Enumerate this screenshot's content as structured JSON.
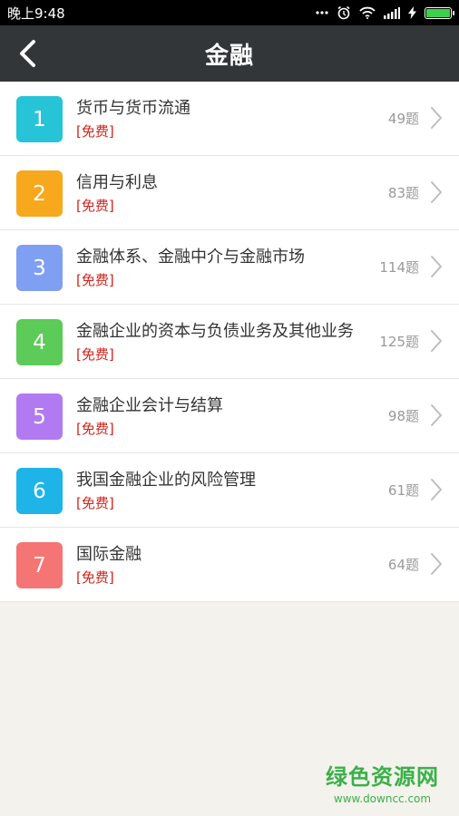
{
  "status_bar": {
    "time": "晚上9:48",
    "signal_icon": "signal-icon",
    "wifi_icon": "wifi-icon",
    "alarm_icon": "alarm-clock-icon",
    "charging_icon": "charging-bolt-icon",
    "battery_icon": "battery-icon",
    "battery_level": 1.0
  },
  "header": {
    "title": "金融",
    "back_icon": "back-arrow-icon"
  },
  "list": {
    "items": [
      {
        "number": "1",
        "title": "货币与货币流通",
        "tag": "[免费]",
        "count": "49题",
        "color": "#27c3d6"
      },
      {
        "number": "2",
        "title": "信用与利息",
        "tag": "[免费]",
        "count": "83题",
        "color": "#f7a81c"
      },
      {
        "number": "3",
        "title": "金融体系、金融中介与金融市场",
        "tag": "[免费]",
        "count": "114题",
        "color": "#7f9ff3"
      },
      {
        "number": "4",
        "title": "金融企业的资本与负债业务及其他业务",
        "tag": "[免费]",
        "count": "125题",
        "color": "#5ccb57"
      },
      {
        "number": "5",
        "title": "金融企业会计与结算",
        "tag": "[免费]",
        "count": "98题",
        "color": "#b27af0"
      },
      {
        "number": "6",
        "title": "我国金融企业的风险管理",
        "tag": "[免费]",
        "count": "61题",
        "color": "#1eb4e8"
      },
      {
        "number": "7",
        "title": "国际金融",
        "tag": "[免费]",
        "count": "64题",
        "color": "#f57474"
      }
    ]
  },
  "watermark": {
    "title": "绿色资源网",
    "url": "www.downcc.com"
  }
}
